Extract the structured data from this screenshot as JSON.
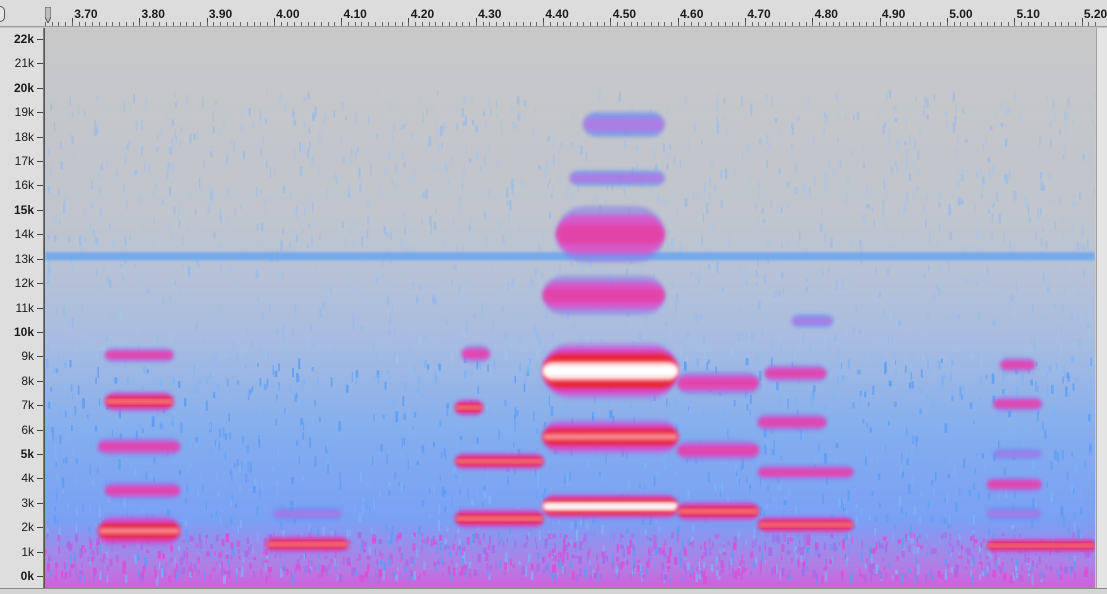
{
  "timeline": {
    "labels": [
      "3.70",
      "3.80",
      "3.90",
      "4.00",
      "4.10",
      "4.20",
      "4.30",
      "4.40",
      "4.50",
      "4.60",
      "4.70",
      "4.80",
      "4.90",
      "5.00",
      "5.10",
      "5.20"
    ],
    "start": 3.66,
    "end": 5.22
  },
  "frequency_axis": {
    "labels": [
      "22k",
      "21k",
      "20k",
      "19k",
      "18k",
      "17k",
      "16k",
      "15k",
      "14k",
      "13k",
      "12k",
      "11k",
      "10k",
      "9k",
      "8k",
      "7k",
      "6k",
      "5k",
      "4k",
      "3k",
      "2k",
      "1k",
      "0k"
    ],
    "bold_labels": [
      "22k",
      "20k",
      "15k",
      "10k",
      "5k",
      "0k"
    ]
  },
  "spectrogram": {
    "colors": {
      "background": "#c6c6c6",
      "low": "#6aa6f0",
      "mid": "#e040c8",
      "high": "#e8202a",
      "peak": "#ffffff"
    },
    "noise_hum_khz": 13.1,
    "formant_bands": [
      {
        "t0": 3.74,
        "t1": 3.86,
        "f0": 1.3,
        "f1": 2.4,
        "level": 3
      },
      {
        "t0": 3.75,
        "t1": 3.86,
        "f0": 3.2,
        "f1": 3.8,
        "level": 2
      },
      {
        "t0": 3.74,
        "t1": 3.86,
        "f0": 5.0,
        "f1": 5.6,
        "level": 2
      },
      {
        "t0": 3.75,
        "t1": 3.85,
        "f0": 6.8,
        "f1": 7.5,
        "level": 3
      },
      {
        "t0": 3.75,
        "t1": 3.85,
        "f0": 8.8,
        "f1": 9.3,
        "level": 2
      },
      {
        "t0": 3.99,
        "t1": 4.11,
        "f0": 1.0,
        "f1": 1.6,
        "level": 3
      },
      {
        "t0": 4.0,
        "t1": 4.1,
        "f0": 2.3,
        "f1": 2.8,
        "level": 1
      },
      {
        "t0": 4.27,
        "t1": 4.4,
        "f0": 2.0,
        "f1": 2.7,
        "level": 3
      },
      {
        "t0": 4.27,
        "t1": 4.4,
        "f0": 4.4,
        "f1": 5.0,
        "level": 3
      },
      {
        "t0": 4.27,
        "t1": 4.31,
        "f0": 6.6,
        "f1": 7.2,
        "level": 3
      },
      {
        "t0": 4.28,
        "t1": 4.32,
        "f0": 8.8,
        "f1": 9.4,
        "level": 2
      },
      {
        "t0": 4.4,
        "t1": 4.6,
        "f0": 2.4,
        "f1": 3.3,
        "level": 4
      },
      {
        "t0": 4.4,
        "t1": 4.6,
        "f0": 5.1,
        "f1": 6.3,
        "level": 3
      },
      {
        "t0": 4.4,
        "t1": 4.6,
        "f0": 7.4,
        "f1": 9.4,
        "level": 4
      },
      {
        "t0": 4.4,
        "t1": 4.58,
        "f0": 10.8,
        "f1": 12.2,
        "level": 2
      },
      {
        "t0": 4.42,
        "t1": 4.58,
        "f0": 13.0,
        "f1": 15.0,
        "level": 2
      },
      {
        "t0": 4.6,
        "t1": 4.72,
        "f0": 2.3,
        "f1": 3.0,
        "level": 3
      },
      {
        "t0": 4.6,
        "t1": 4.72,
        "f0": 4.8,
        "f1": 5.5,
        "level": 2
      },
      {
        "t0": 4.6,
        "t1": 4.72,
        "f0": 7.5,
        "f1": 8.3,
        "level": 2
      },
      {
        "t0": 4.72,
        "t1": 4.86,
        "f0": 1.8,
        "f1": 2.4,
        "level": 3
      },
      {
        "t0": 4.72,
        "t1": 4.86,
        "f0": 4.0,
        "f1": 4.5,
        "level": 2
      },
      {
        "t0": 4.72,
        "t1": 4.82,
        "f0": 6.0,
        "f1": 6.6,
        "level": 2
      },
      {
        "t0": 4.73,
        "t1": 4.82,
        "f0": 8.0,
        "f1": 8.6,
        "level": 2
      },
      {
        "t0": 4.77,
        "t1": 4.83,
        "f0": 10.2,
        "f1": 10.7,
        "level": 1
      },
      {
        "t0": 5.06,
        "t1": 5.22,
        "f0": 1.0,
        "f1": 1.5,
        "level": 3
      },
      {
        "t0": 5.06,
        "t1": 5.14,
        "f0": 2.3,
        "f1": 2.8,
        "level": 1
      },
      {
        "t0": 5.06,
        "t1": 5.14,
        "f0": 3.5,
        "f1": 4.0,
        "level": 2
      },
      {
        "t0": 5.07,
        "t1": 5.14,
        "f0": 4.8,
        "f1": 5.2,
        "level": 1
      },
      {
        "t0": 5.07,
        "t1": 5.14,
        "f0": 6.8,
        "f1": 7.3,
        "level": 2
      },
      {
        "t0": 5.08,
        "t1": 5.13,
        "f0": 8.4,
        "f1": 8.9,
        "level": 2
      },
      {
        "t0": 4.44,
        "t1": 4.58,
        "f0": 16.0,
        "f1": 16.6,
        "level": 1
      },
      {
        "t0": 4.46,
        "t1": 4.58,
        "f0": 18.0,
        "f1": 19.0,
        "level": 1
      }
    ]
  }
}
